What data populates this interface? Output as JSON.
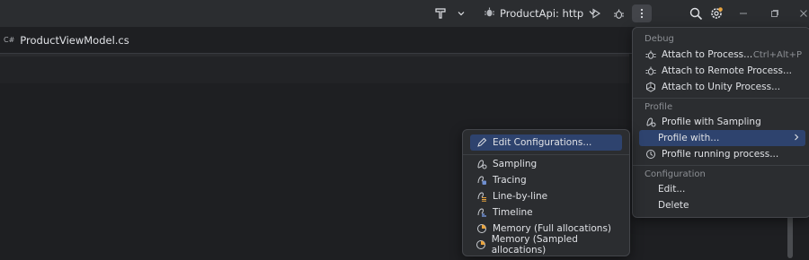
{
  "titlebar": {
    "run_configuration": "ProductApi: http"
  },
  "editor": {
    "tab_icon_text": "C#",
    "tab_label": "ProductViewModel.cs"
  },
  "run_menu": {
    "debug_header": "Debug",
    "debug_items": [
      {
        "label": "Attach to Process...",
        "shortcut": "Ctrl+Alt+P",
        "icon": "attach-process-icon"
      },
      {
        "label": "Attach to Remote Process...",
        "icon": "attach-remote-icon"
      },
      {
        "label": "Attach to Unity Process...",
        "icon": "unity-icon"
      }
    ],
    "profile_header": "Profile",
    "profile_items": [
      {
        "label": "Profile with Sampling",
        "icon": "sampling-icon"
      },
      {
        "label": "Profile with...",
        "selected": true
      },
      {
        "label": "Profile running process...",
        "icon": "profile-running-icon"
      }
    ],
    "configuration_header": "Configuration",
    "configuration_items": [
      {
        "label": "Edit..."
      },
      {
        "label": "Delete"
      }
    ]
  },
  "profile_with_submenu": {
    "items": [
      {
        "label": "Edit Configurations...",
        "selected": true,
        "icon": "pencil-icon"
      },
      {
        "label": "Sampling",
        "icon": "sampling-icon"
      },
      {
        "label": "Tracing",
        "icon": "tracing-icon"
      },
      {
        "label": "Line-by-line",
        "icon": "line-by-line-icon"
      },
      {
        "label": "Timeline",
        "icon": "timeline-icon"
      },
      {
        "label": "Memory (Full allocations)",
        "icon": "memory-icon"
      },
      {
        "label": "Memory (Sampled allocations)",
        "icon": "memory-icon"
      }
    ]
  },
  "colors": {
    "selection": "#2e436e",
    "popup_bg": "#2b2d30",
    "editor_bg": "#1e1f22",
    "accent_badge": "#e8a33d"
  }
}
